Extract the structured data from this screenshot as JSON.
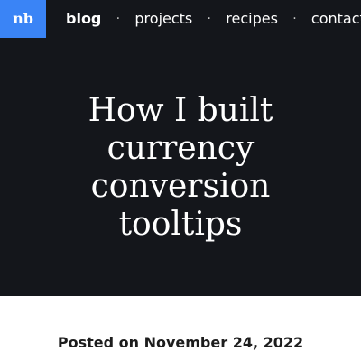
{
  "logo": {
    "label": "nb"
  },
  "nav": {
    "items": [
      {
        "label": "blog"
      },
      {
        "label": "projects"
      },
      {
        "label": "recipes"
      },
      {
        "label": "contact"
      }
    ],
    "separator": "·"
  },
  "hero": {
    "title": "How I built currency conversion tooltips"
  },
  "post": {
    "posted_prefix": "Posted on",
    "date": "November 24, 2022"
  },
  "colors": {
    "hero_background": "#14161b",
    "logo_background": "#3a84f6",
    "text_light": "#ffffff",
    "text_dark": "#1d1d1d"
  }
}
